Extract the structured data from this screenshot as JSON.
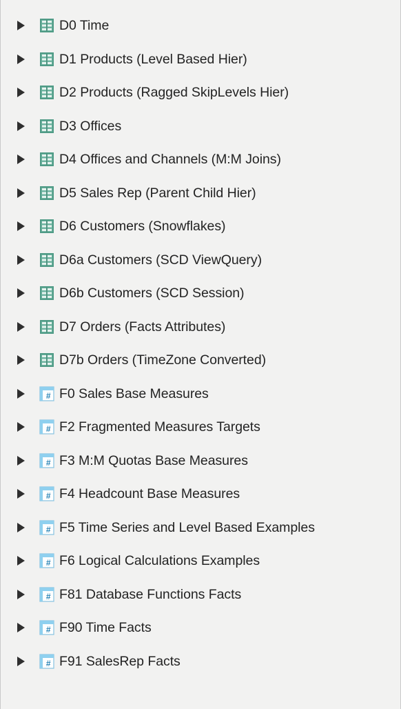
{
  "tree": {
    "items": [
      {
        "label": "D0 Time",
        "type": "dimension"
      },
      {
        "label": "D1 Products (Level Based Hier)",
        "type": "dimension"
      },
      {
        "label": "D2 Products (Ragged SkipLevels Hier)",
        "type": "dimension"
      },
      {
        "label": "D3 Offices",
        "type": "dimension"
      },
      {
        "label": "D4 Offices and Channels (M:M Joins)",
        "type": "dimension"
      },
      {
        "label": "D5 Sales Rep (Parent Child Hier)",
        "type": "dimension"
      },
      {
        "label": "D6 Customers (Snowflakes)",
        "type": "dimension"
      },
      {
        "label": "D6a Customers (SCD ViewQuery)",
        "type": "dimension"
      },
      {
        "label": "D6b Customers (SCD Session)",
        "type": "dimension"
      },
      {
        "label": "D7 Orders (Facts Attributes)",
        "type": "dimension"
      },
      {
        "label": "D7b Orders (TimeZone Converted)",
        "type": "dimension"
      },
      {
        "label": "F0 Sales Base Measures",
        "type": "fact"
      },
      {
        "label": "F2 Fragmented Measures Targets",
        "type": "fact"
      },
      {
        "label": "F3 M:M Quotas Base Measures",
        "type": "fact"
      },
      {
        "label": "F4 Headcount Base Measures",
        "type": "fact"
      },
      {
        "label": "F5 Time Series and Level Based Examples",
        "type": "fact"
      },
      {
        "label": "F6 Logical Calculations Examples",
        "type": "fact"
      },
      {
        "label": "F81 Database Functions Facts",
        "type": "fact"
      },
      {
        "label": "F90 Time Facts",
        "type": "fact"
      },
      {
        "label": "F91 SalesRep Facts",
        "type": "fact"
      }
    ]
  },
  "icons": {
    "dimension": "dimension-table-icon",
    "fact": "fact-table-icon",
    "expander": "expand-arrow-icon"
  },
  "colors": {
    "background": "#f2f2f1",
    "text": "#232323",
    "dimension_icon": "#4f9b86",
    "fact_icon_frame": "#5a9fc0",
    "fact_icon_mark": "#2b85b6",
    "arrow": "#2f2f2f"
  }
}
